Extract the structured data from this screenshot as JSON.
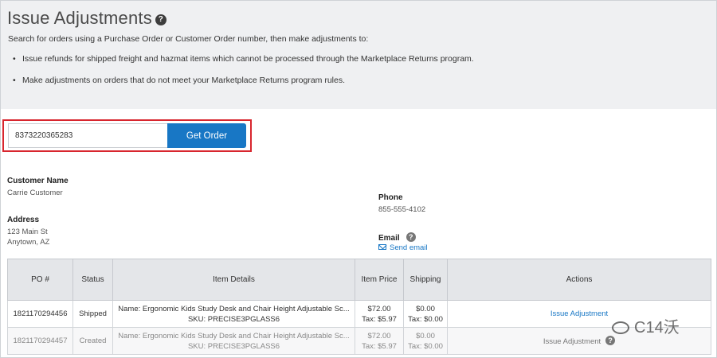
{
  "header": {
    "title": "Issue Adjustments",
    "help": "?",
    "subtitle": "Search for orders using a Purchase Order or Customer Order number, then make adjustments to:",
    "bullets": [
      "Issue refunds for shipped freight and hazmat items which cannot be processed through the Marketplace Returns program.",
      "Make adjustments on orders that do not meet your Marketplace Returns program rules."
    ]
  },
  "search": {
    "value": "8373220365283",
    "button_label": "Get Order"
  },
  "customer": {
    "name_label": "Customer Name",
    "name": "Carrie Customer",
    "address_label": "Address",
    "address_line1": "123 Main St",
    "address_line2": "Anytown, AZ",
    "phone_label": "Phone",
    "phone": "855-555-4102",
    "email_label": "Email",
    "email_help": "?",
    "send_email": "Send email"
  },
  "table": {
    "headers": [
      "PO #",
      "Status",
      "Item Details",
      "Item Price",
      "Shipping",
      "Actions"
    ],
    "rows": [
      {
        "po": "1821170294456",
        "status": "Shipped",
        "name": "Name: Ergonomic Kids Study Desk and Chair Height Adjustable Sc...",
        "sku": "SKU: PRECISE3PGLASS6",
        "price": "$72.00",
        "price_tax": "Tax: $5.97",
        "shipping": "$0.00",
        "shipping_tax": "Tax: $0.00",
        "action": "Issue Adjustment"
      },
      {
        "po": "1821170294457",
        "status": "Created",
        "name": "Name: Ergonomic Kids Study Desk and Chair Height Adjustable Sc...",
        "sku": "SKU: PRECISE3PGLASS6",
        "price": "$72.00",
        "price_tax": "Tax: $5.97",
        "shipping": "$0.00",
        "shipping_tax": "Tax: $0.00",
        "action": "Issue Adjustment",
        "action_help": "?"
      }
    ]
  },
  "watermark": "C14沃"
}
